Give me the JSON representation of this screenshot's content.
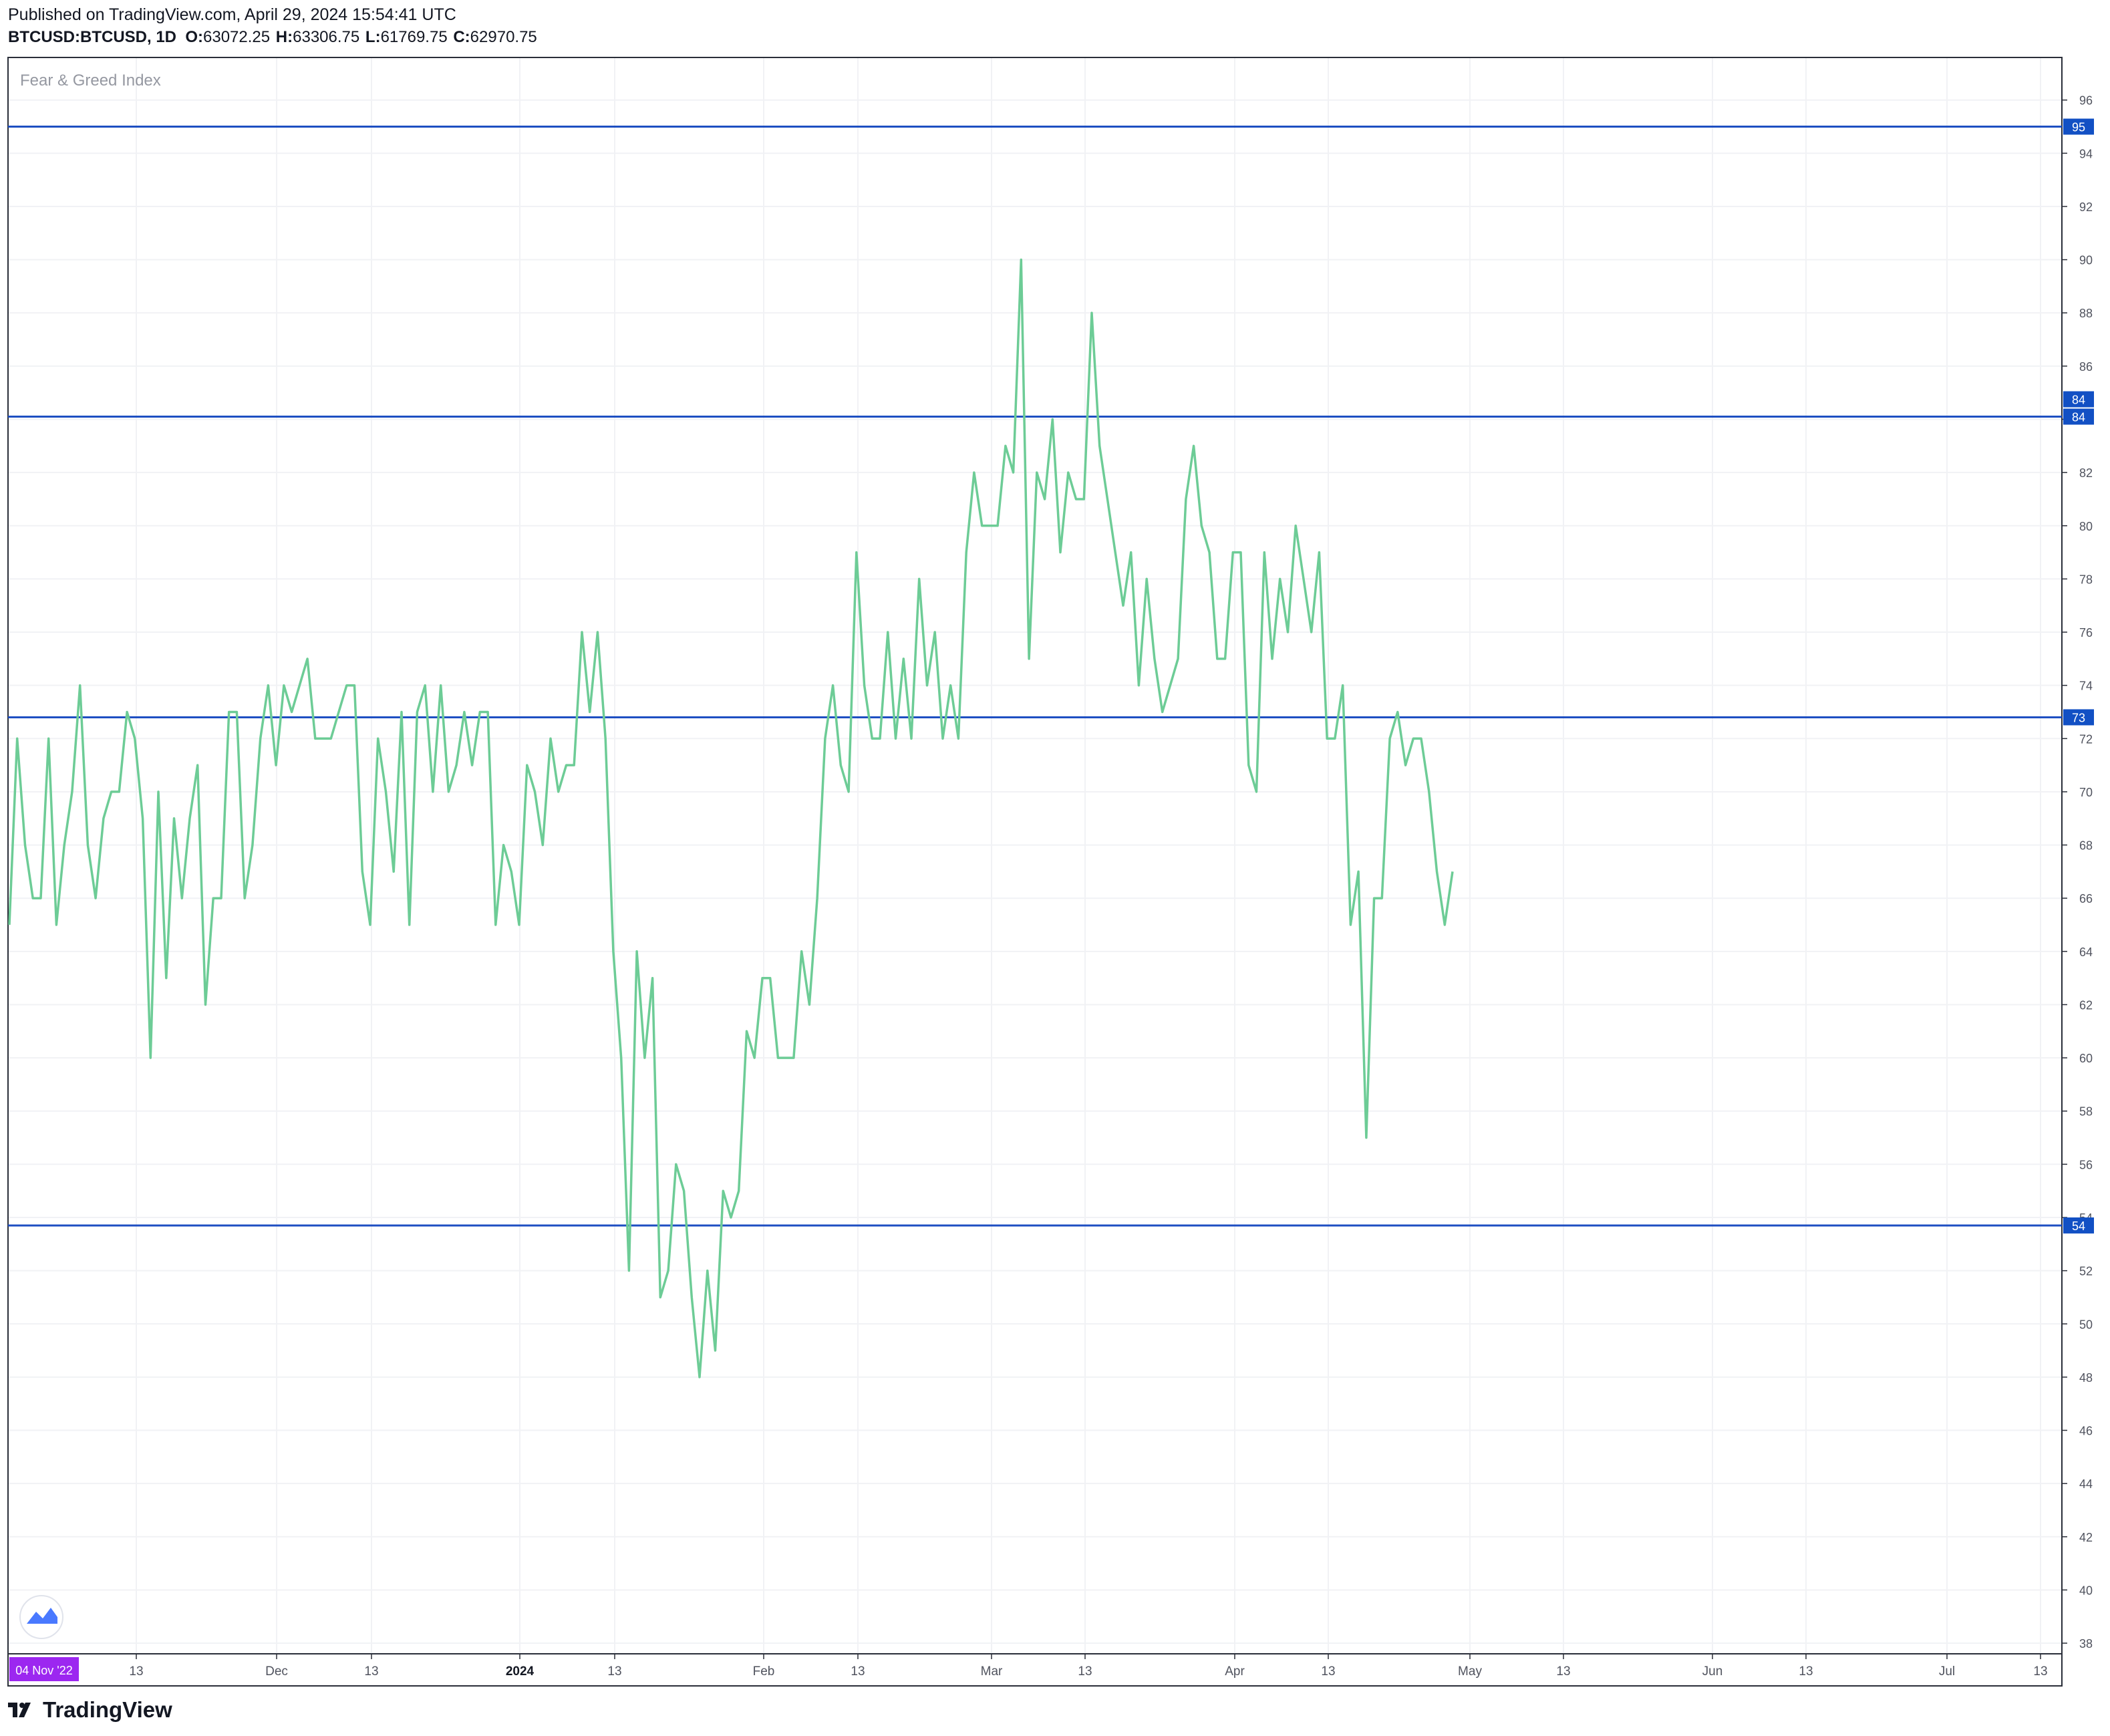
{
  "header": {
    "published": "Published on TradingView.com, April 29, 2024 15:54:41 UTC",
    "symbol": "BTCUSD:BTCUSD, 1D",
    "ohlc": {
      "o_label": "O:",
      "o_value": "63072.25",
      "h_label": "H:",
      "h_value": "63306.75",
      "l_label": "L:",
      "l_value": "61769.75",
      "c_label": "C:",
      "c_value": "62970.75"
    }
  },
  "footer": {
    "brand": "TradingView"
  },
  "colors": {
    "line": "#6dcc96",
    "hline": "#1e4fc2",
    "label_bg": "#1250c4",
    "date_badge": "#9c27f0",
    "grid": "#f1f2f5"
  },
  "chart_data": {
    "type": "line",
    "title": "Fear & Greed Index",
    "ylim": [
      37.6,
      97.6
    ],
    "y_ticks": [
      38,
      40,
      42,
      44,
      46,
      48,
      50,
      52,
      54,
      56,
      58,
      60,
      62,
      64,
      66,
      68,
      70,
      72,
      74,
      76,
      78,
      80,
      82,
      84,
      86,
      88,
      90,
      92,
      94,
      96
    ],
    "x_ticks": [
      "13",
      "Dec",
      "13",
      "2024",
      "13",
      "Feb",
      "13",
      "Mar",
      "13",
      "Apr",
      "13",
      "May",
      "13",
      "Jun",
      "13",
      "Jul",
      "13"
    ],
    "x_badge": "04 Nov '22",
    "horizontal_lines": [
      {
        "value": 95,
        "label": "95"
      },
      {
        "value": 84.1,
        "label": "84"
      },
      {
        "value": 72.8,
        "label": "73"
      },
      {
        "value": 53.7,
        "label": "54"
      }
    ],
    "extra_axis_label": "84",
    "series": [
      {
        "values": [
          65,
          72,
          68,
          66,
          66,
          72,
          65,
          68,
          70,
          74,
          68,
          66,
          69,
          70,
          70,
          73,
          72,
          69,
          60,
          70,
          63,
          69,
          66,
          69,
          71,
          62,
          66,
          66,
          73,
          73,
          66,
          68,
          72,
          74,
          71,
          74,
          73,
          74,
          75,
          72,
          72,
          72,
          73,
          74,
          74,
          67,
          65,
          72,
          70,
          67,
          73,
          65,
          73,
          74,
          70,
          74,
          70,
          71,
          73,
          71,
          73,
          73,
          65,
          68,
          67,
          65,
          71,
          70,
          68,
          72,
          70,
          71,
          71,
          76,
          73,
          76,
          72,
          64,
          60,
          52,
          64,
          60,
          63,
          51,
          52,
          56,
          55,
          51,
          48,
          52,
          49,
          55,
          54,
          55,
          61,
          60,
          63,
          63,
          60,
          60,
          60,
          64,
          62,
          66,
          72,
          74,
          71,
          70,
          79,
          74,
          72,
          72,
          76,
          72,
          75,
          72,
          78,
          74,
          76,
          72,
          74,
          72,
          79,
          82,
          80,
          80,
          80,
          83,
          82,
          90,
          75,
          82,
          81,
          84,
          79,
          82,
          81,
          81,
          88,
          83,
          81,
          79,
          77,
          79,
          74,
          78,
          75,
          73,
          74,
          75,
          81,
          83,
          80,
          79,
          75,
          75,
          79,
          79,
          71,
          70,
          79,
          75,
          78,
          76,
          80,
          78,
          76,
          79,
          72,
          72,
          74,
          65,
          67,
          57,
          66,
          66,
          72,
          73,
          71,
          72,
          72,
          70,
          67,
          65,
          67
        ]
      }
    ]
  }
}
